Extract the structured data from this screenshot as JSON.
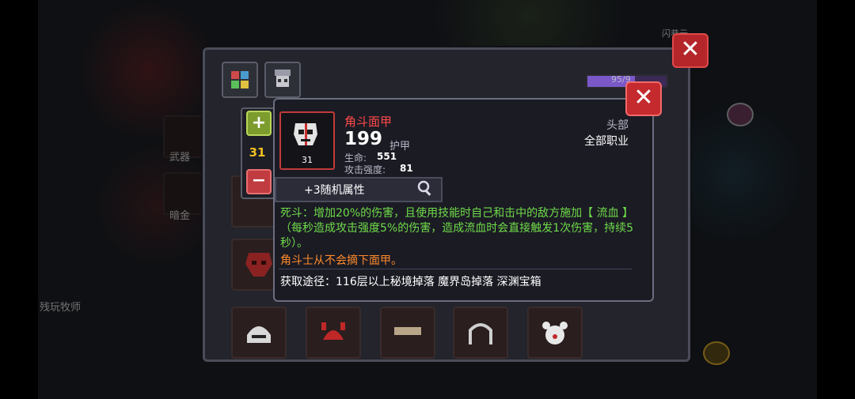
{
  "tooltip": {
    "item_name": "角斗面甲",
    "item_level": "31",
    "armor_value": "199",
    "armor_label": "护甲",
    "stat_health_label": "生命:",
    "stat_health_value": "551",
    "stat_attack_label": "攻击强度:",
    "stat_attack_value": "81",
    "slot_type": "头部",
    "class_restriction": "全部职业",
    "random_attributes": "+3随机属性",
    "description": "死斗：增加20%的伤害，且使用技能时自己和击中的敌方施加【 流血 】（每秒造成攻击强度5%的伤害，造成流血时会直接触发1次伤害，持续5秒）。",
    "flavor_text": "角斗士从不会摘下面甲。",
    "source_text": "获取途径：116层以上秘境掉落 魔界岛掉落 深渊宝箱",
    "close_label": "✕"
  },
  "level_control": {
    "plus_label": "+",
    "level": "31",
    "minus_label": "−"
  },
  "panel": {
    "close_label": "✕",
    "bar_text": "95/9"
  },
  "background": {
    "left_tab_weapon": "武器",
    "left_tab_gold": "暗金",
    "left_text_npc": "残玩牧师",
    "top_right_text": "闪巷云"
  },
  "colors": {
    "rarity_red": "#ff4a4a",
    "effect_green": "#6fdc49",
    "flavor_orange": "#ff8a2a",
    "level_yellow": "#f0c020"
  }
}
